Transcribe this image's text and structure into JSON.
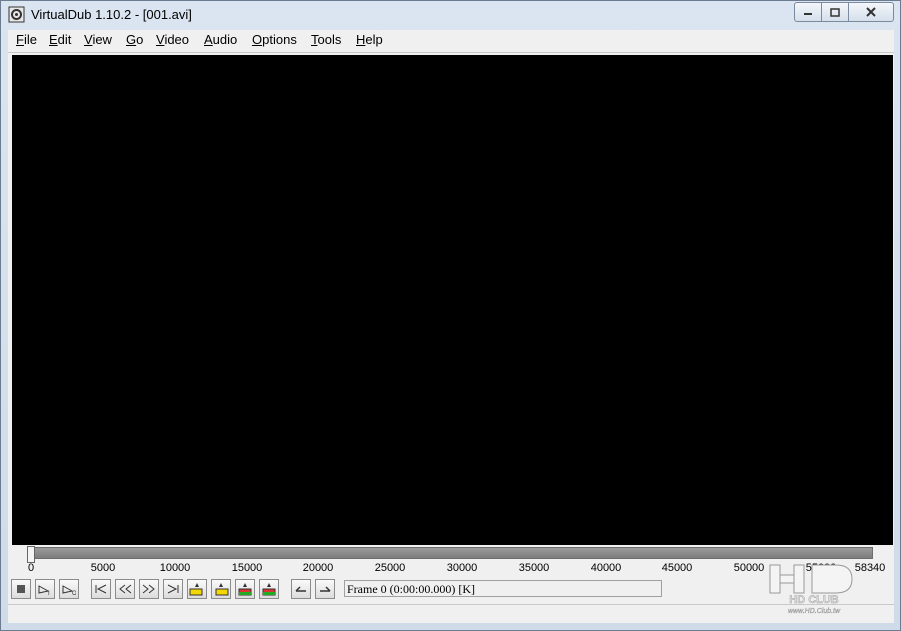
{
  "window": {
    "title": "VirtualDub 1.10.2 - [001.avi]"
  },
  "menu": [
    "File",
    "Edit",
    "View",
    "Go",
    "Video",
    "Audio",
    "Options",
    "Tools",
    "Help"
  ],
  "timeline": {
    "ticks": [
      "0",
      "5000",
      "10000",
      "15000",
      "20000",
      "25000",
      "30000",
      "35000",
      "40000",
      "45000",
      "50000",
      "55000",
      "58340"
    ],
    "position_frame": 0,
    "total_frames": 58340
  },
  "status": {
    "frame_text": "Frame 0 (0:00:00.000) [K]"
  },
  "toolbar": {
    "buttons": [
      "stop-icon",
      "play-input-icon",
      "play-output-icon",
      "start-icon",
      "prev-frame-icon",
      "next-frame-icon",
      "end-icon",
      "prev-keyframe-icon",
      "next-keyframe-icon",
      "scene-back-icon",
      "scene-forward-icon",
      "mark-in-icon",
      "mark-out-icon"
    ]
  },
  "watermark": {
    "text": "HD CLUB",
    "url": "www.HD.Club.tw"
  }
}
